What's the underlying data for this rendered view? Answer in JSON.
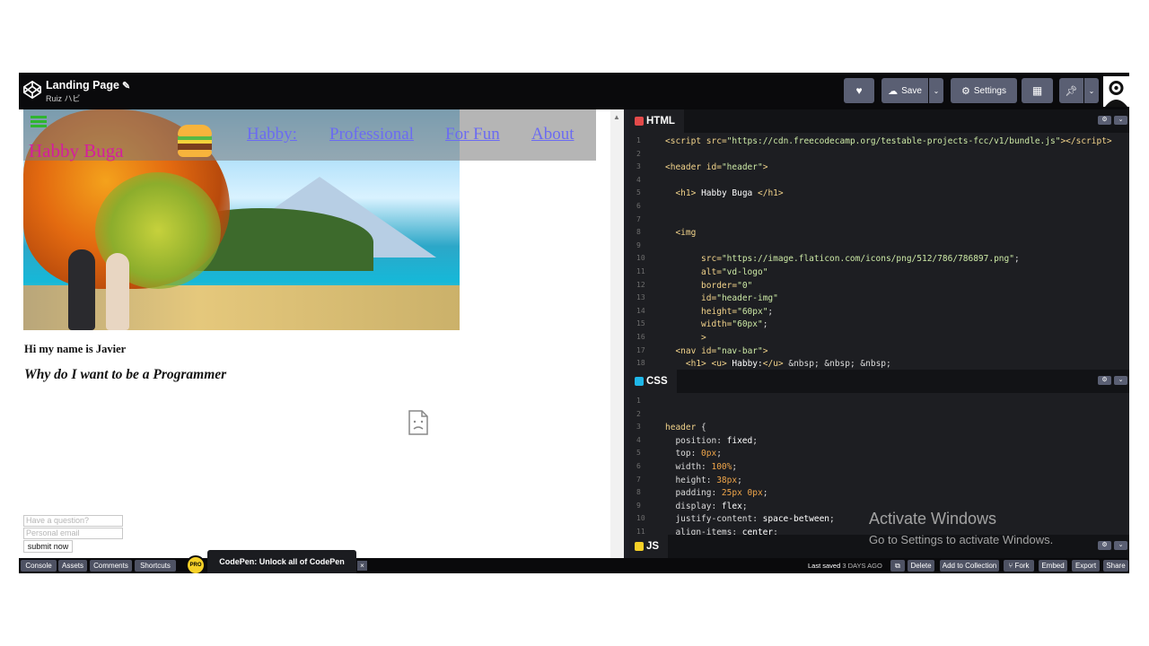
{
  "header": {
    "title": "Landing Page",
    "author": "Ruiz ハビ",
    "buttons": {
      "save": "Save",
      "settings": "Settings"
    }
  },
  "preview": {
    "brand": "Habby Buga",
    "nav": [
      "Habby:",
      "Professional",
      "For Fun",
      "About"
    ],
    "intro": "Hi my name is Javier",
    "question": "Why do I want to be a Programmer",
    "form": {
      "question_placeholder": "Have a question?",
      "email_placeholder": "Personal email",
      "submit": "submit now"
    }
  },
  "editors": {
    "html": {
      "label": "HTML",
      "color": "#e24a4a",
      "lines": [
        {
          "n": "1",
          "html": "<span class='tg'>&lt;script</span> <span class='at'>src=</span><span class='st'>\"https://cdn.freecodecamp.org/testable-projects-fcc/v1/bundle.js\"</span><span class='tg'>&gt;&lt;/script&gt;</span>"
        },
        {
          "n": "2",
          "html": ""
        },
        {
          "n": "3",
          "html": "<span class='tg'>&lt;header</span> <span class='at'>id=</span><span class='st'>\"header\"</span><span class='tg'>&gt;</span>"
        },
        {
          "n": "4",
          "html": ""
        },
        {
          "n": "5",
          "html": "  <span class='tg'>&lt;h1&gt;</span> <span class='kw'>Habby Buga</span> <span class='tg'>&lt;/h1&gt;</span>"
        },
        {
          "n": "6",
          "html": ""
        },
        {
          "n": "7",
          "html": ""
        },
        {
          "n": "8",
          "html": "  <span class='tg'>&lt;img</span>"
        },
        {
          "n": "9",
          "html": ""
        },
        {
          "n": "10",
          "html": "       <span class='at'>src=</span><span class='st'>\"https://image.flaticon.com/icons/png/512/786/786897.png\"</span>;"
        },
        {
          "n": "11",
          "html": "       <span class='at'>alt=</span><span class='st'>\"vd-logo\"</span>"
        },
        {
          "n": "12",
          "html": "       <span class='at'>border=</span><span class='st'>\"0\"</span>"
        },
        {
          "n": "13",
          "html": "       <span class='at'>id=</span><span class='st'>\"header-img\"</span>"
        },
        {
          "n": "14",
          "html": "       <span class='at'>height=</span><span class='st'>\"60px\"</span>;"
        },
        {
          "n": "15",
          "html": "       <span class='at'>width=</span><span class='st'>\"60px\"</span>;"
        },
        {
          "n": "16",
          "html": "       <span class='tg'>&gt;</span>"
        },
        {
          "n": "17",
          "html": "  <span class='tg'>&lt;nav</span> <span class='at'>id=</span><span class='st'>\"nav-bar\"</span><span class='tg'>&gt;</span>"
        },
        {
          "n": "18",
          "html": "    <span class='tg'>&lt;h1&gt;</span> <span class='tg'>&lt;u&gt;</span> <span class='kw'>Habby:</span><span class='tg'>&lt;/u&gt;</span> &amp;nbsp; &amp;nbsp; &amp;nbsp;"
        }
      ]
    },
    "css": {
      "label": "CSS",
      "color": "#1fb7e8",
      "lines": [
        {
          "n": "1",
          "html": ""
        },
        {
          "n": "2",
          "html": ""
        },
        {
          "n": "3",
          "html": "<span class='tg'>header</span> {"
        },
        {
          "n": "4",
          "html": "  position: <span class='kw'>fixed</span>;"
        },
        {
          "n": "5",
          "html": "  top: <span class='nm'>0px</span>;"
        },
        {
          "n": "6",
          "html": "  width: <span class='nm'>100%</span>;"
        },
        {
          "n": "7",
          "html": "  height: <span class='nm'>38px</span>;"
        },
        {
          "n": "8",
          "html": "  padding: <span class='nm'>25px 0px</span>;"
        },
        {
          "n": "9",
          "html": "  display: <span class='kw'>flex</span>;"
        },
        {
          "n": "10",
          "html": "  justify-content: <span class='kw'>space-between</span>;"
        },
        {
          "n": "11",
          "html": "  align-items: <span class='kw'>center</span>;"
        }
      ]
    },
    "js": {
      "label": "JS",
      "color": "#f5d027"
    }
  },
  "watermark": {
    "line1": "Activate Windows",
    "line2": "Go to Settings to activate Windows."
  },
  "bottom": {
    "console": "Console",
    "assets": "Assets",
    "comments": "Comments",
    "shortcuts": "Shortcuts",
    "pro": "PRO",
    "promo": "CodePen: Unlock all of CodePen",
    "close": "×",
    "saved_label": "Last saved",
    "saved_time": "3 DAYS AGO",
    "delete": "Delete",
    "collection": "Add to Collection",
    "fork": "Fork",
    "embed": "Embed",
    "export": "Export",
    "share": "Share"
  }
}
